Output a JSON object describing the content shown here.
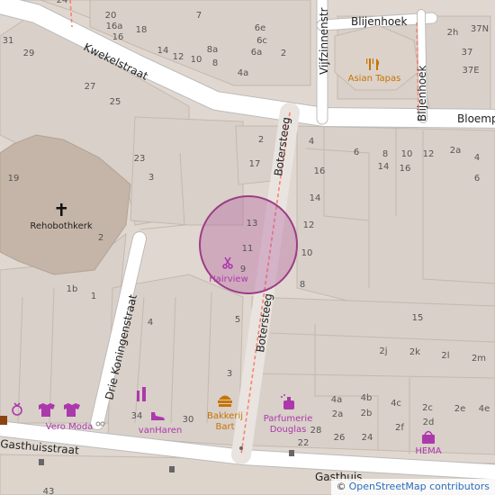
{
  "streets": {
    "kwekelstraat": "Kwekelstraat",
    "vijfzinnenstraat": "Vijfzinnenstr",
    "blijenhoek_top": "Blijenhoek",
    "blijenhoek_vertical": "Blijenhoek",
    "bloemp": "Bloemp",
    "botersteeg_upper": "Botersteeg",
    "botersteeg_lower": "Botersteeg",
    "drie_koningenstraat": "Drie Koningenstraat",
    "gasthuisstraat": "Gasthuisstraat",
    "gasthuis_bottom": "Gasthuis"
  },
  "places": {
    "rehobothkerk": "Rehobothkerk",
    "asian_tapas": "Asian Tapas",
    "hairview": "Hairview",
    "vero_moda": "Vero Moda",
    "vanharen": "vanHaren",
    "bakkerij_bart_line1": "Bakkerij",
    "bakkerij_bart_line2": "Bart",
    "parfumerie_line1": "Parfumerie",
    "parfumerie_line2": "Douglas",
    "hema": "HEMA"
  },
  "house_numbers": [
    "24",
    "20",
    "16a",
    "16",
    "18",
    "7",
    "31",
    "29",
    "14",
    "12",
    "10",
    "8a",
    "8",
    "6e",
    "6c",
    "6a",
    "2",
    "4a",
    "27",
    "25",
    "23",
    "19",
    "3",
    "2",
    "13",
    "11",
    "9",
    "2",
    "17",
    "16",
    "14",
    "12",
    "10",
    "8",
    "4",
    "6",
    "8",
    "14",
    "10",
    "16",
    "12",
    "2a",
    "4",
    "6",
    "15",
    "2j",
    "2k",
    "2l",
    "2m",
    "4a",
    "4b",
    "4c",
    "2a",
    "2b",
    "2c",
    "2d",
    "2e",
    "4e",
    "22",
    "28",
    "26",
    "24",
    "2f",
    "1b",
    "1",
    "4",
    "5",
    "3",
    "34",
    "30",
    "2h",
    "37N",
    "37",
    "37E",
    "43"
  ],
  "attribution": {
    "symbol": "©",
    "link_text": "OpenStreetMap contributors"
  },
  "colors": {
    "background": "#e0d8d0",
    "building": "#d9d0c9",
    "building_stroke": "#c4b9ae",
    "church": "#c4b5a8",
    "road": "#ffffff",
    "footway": "#fa8072",
    "highlight_fill": "#b0579a",
    "poi_food": "#c77400",
    "poi_shop": "#ac39ac"
  },
  "icons": [
    "church-cross-icon",
    "restaurant-icon",
    "hairdresser-icon",
    "clothes-icon",
    "jewelry-icon",
    "shoes-icon",
    "bakery-icon",
    "perfume-icon",
    "department-store-icon",
    "waste-basket-icon",
    "bicycle-icon"
  ]
}
